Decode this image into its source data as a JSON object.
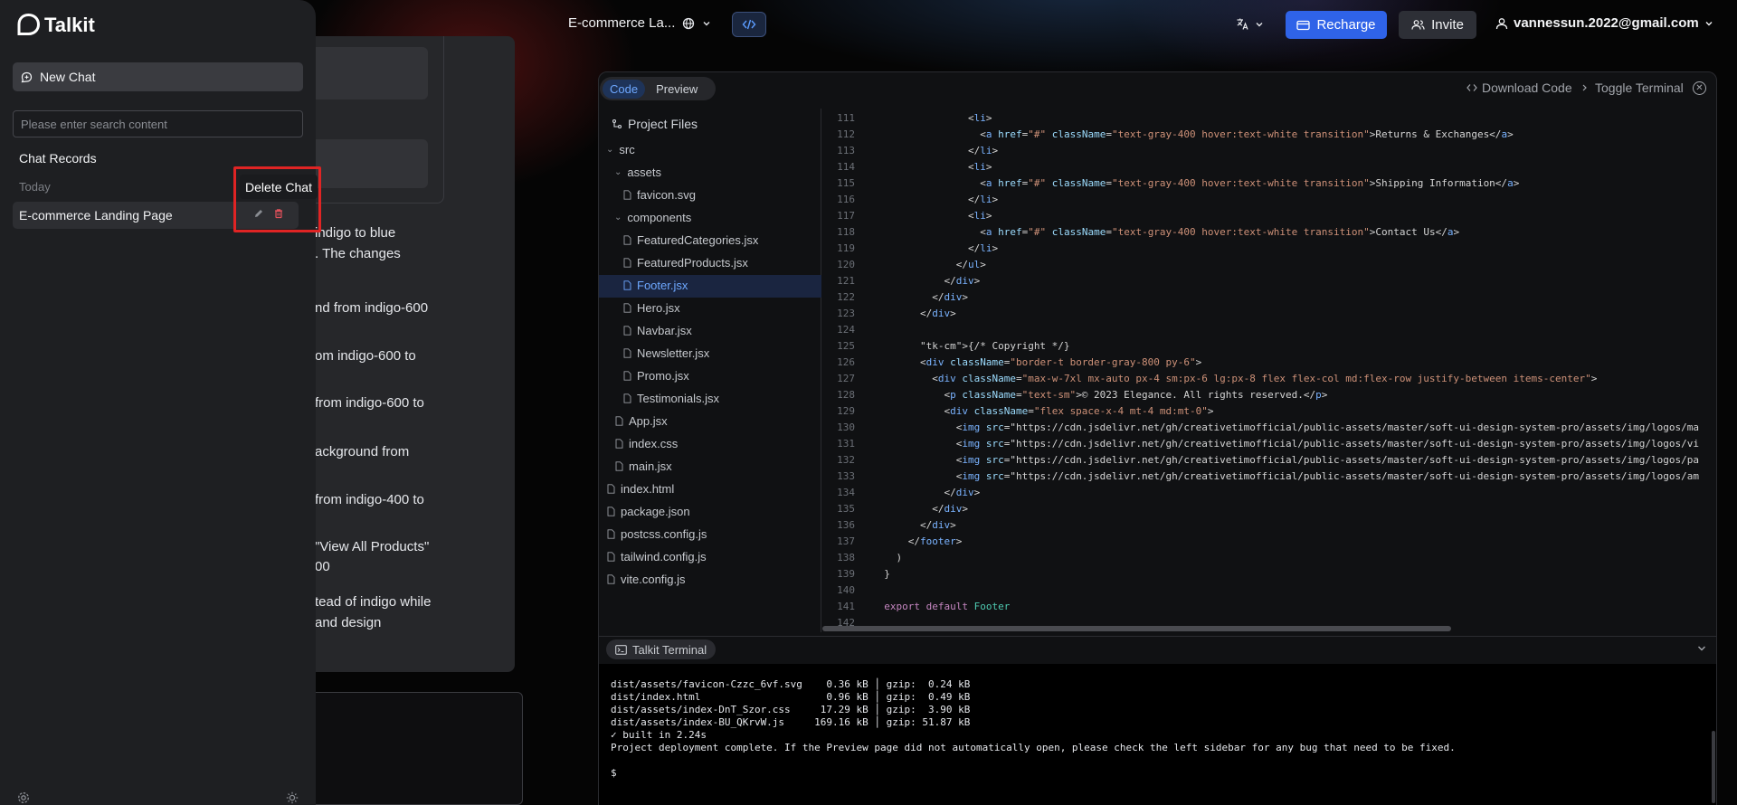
{
  "topbar": {
    "project_title": "E-commerce La...",
    "recharge_label": "Recharge",
    "invite_label": "Invite",
    "account_email": "vannessun.2022@gmail.com"
  },
  "sidebar": {
    "brand": "Talkit",
    "new_chat_label": "New Chat",
    "search_placeholder": "Please enter search content",
    "records_title": "Chat Records",
    "today_label": "Today",
    "chat_item_label": "E-commerce Landing Page",
    "tooltip": "Delete Chat"
  },
  "chat_background": {
    "lines": [
      "indigo to blue",
      ". The changes",
      "nd from indigo-600",
      "om indigo-600 to",
      "from indigo-600 to",
      "ackground from",
      "from indigo-400 to",
      "\"View All Products\"",
      "00",
      "tead of indigo while",
      "and design"
    ]
  },
  "panel": {
    "tab_code": "Code",
    "tab_preview": "Preview",
    "download_label": "Download Code",
    "toggle_terminal_label": "Toggle Terminal",
    "project_files_label": "Project Files",
    "tree": [
      {
        "name": "src",
        "kind": "folder"
      },
      {
        "name": "assets",
        "kind": "folder"
      },
      {
        "name": "favicon.svg",
        "kind": "file"
      },
      {
        "name": "components",
        "kind": "folder"
      },
      {
        "name": "FeaturedCategories.jsx",
        "kind": "file"
      },
      {
        "name": "FeaturedProducts.jsx",
        "kind": "file"
      },
      {
        "name": "Footer.jsx",
        "kind": "file",
        "active": true
      },
      {
        "name": "Hero.jsx",
        "kind": "file"
      },
      {
        "name": "Navbar.jsx",
        "kind": "file"
      },
      {
        "name": "Newsletter.jsx",
        "kind": "file"
      },
      {
        "name": "Promo.jsx",
        "kind": "file"
      },
      {
        "name": "Testimonials.jsx",
        "kind": "file"
      },
      {
        "name": "App.jsx",
        "kind": "file"
      },
      {
        "name": "index.css",
        "kind": "file"
      },
      {
        "name": "main.jsx",
        "kind": "file"
      },
      {
        "name": "index.html",
        "kind": "file"
      },
      {
        "name": "package.json",
        "kind": "file"
      },
      {
        "name": "postcss.config.js",
        "kind": "file"
      },
      {
        "name": "tailwind.config.js",
        "kind": "file"
      },
      {
        "name": "vite.config.js",
        "kind": "file"
      }
    ]
  },
  "code_lines": [
    {
      "n": "111",
      "t": "                <li>"
    },
    {
      "n": "112",
      "t": "                  <a href=\"#\" className=\"text-gray-400 hover:text-white transition\">Returns & Exchanges</a>"
    },
    {
      "n": "113",
      "t": "                </li>"
    },
    {
      "n": "114",
      "t": "                <li>"
    },
    {
      "n": "115",
      "t": "                  <a href=\"#\" className=\"text-gray-400 hover:text-white transition\">Shipping Information</a>"
    },
    {
      "n": "116",
      "t": "                </li>"
    },
    {
      "n": "117",
      "t": "                <li>"
    },
    {
      "n": "118",
      "t": "                  <a href=\"#\" className=\"text-gray-400 hover:text-white transition\">Contact Us</a>"
    },
    {
      "n": "119",
      "t": "                </li>"
    },
    {
      "n": "120",
      "t": "              </ul>"
    },
    {
      "n": "121",
      "t": "            </div>"
    },
    {
      "n": "122",
      "t": "          </div>"
    },
    {
      "n": "123",
      "t": "        </div>"
    },
    {
      "n": "124",
      "t": ""
    },
    {
      "n": "125",
      "t": "        {/* Copyright */}"
    },
    {
      "n": "126",
      "t": "        <div className=\"border-t border-gray-800 py-6\">"
    },
    {
      "n": "127",
      "t": "          <div className=\"max-w-7xl mx-auto px-4 sm:px-6 lg:px-8 flex flex-col md:flex-row justify-between items-center\">"
    },
    {
      "n": "128",
      "t": "            <p className=\"text-sm\">© 2023 Elegance. All rights reserved.</p>"
    },
    {
      "n": "129",
      "t": "            <div className=\"flex space-x-4 mt-4 md:mt-0\">"
    },
    {
      "n": "130",
      "t": "              <img src=\"https://cdn.jsdelivr.net/gh/creativetimofficial/public-assets/master/soft-ui-design-system-pro/assets/img/logos/ma"
    },
    {
      "n": "131",
      "t": "              <img src=\"https://cdn.jsdelivr.net/gh/creativetimofficial/public-assets/master/soft-ui-design-system-pro/assets/img/logos/vi"
    },
    {
      "n": "132",
      "t": "              <img src=\"https://cdn.jsdelivr.net/gh/creativetimofficial/public-assets/master/soft-ui-design-system-pro/assets/img/logos/pa"
    },
    {
      "n": "133",
      "t": "              <img src=\"https://cdn.jsdelivr.net/gh/creativetimofficial/public-assets/master/soft-ui-design-system-pro/assets/img/logos/am"
    },
    {
      "n": "134",
      "t": "            </div>"
    },
    {
      "n": "135",
      "t": "          </div>"
    },
    {
      "n": "136",
      "t": "        </div>"
    },
    {
      "n": "137",
      "t": "      </footer>"
    },
    {
      "n": "138",
      "t": "    )"
    },
    {
      "n": "139",
      "t": "  }"
    },
    {
      "n": "140",
      "t": ""
    },
    {
      "n": "141",
      "t": "  export default Footer"
    },
    {
      "n": "142",
      "t": ""
    }
  ],
  "terminal": {
    "tab_label": "Talkit Terminal",
    "lines": [
      "dist/assets/favicon-Czzc_6vf.svg    0.36 kB │ gzip:  0.24 kB",
      "dist/index.html                     0.96 kB │ gzip:  0.49 kB",
      "dist/assets/index-DnT_Szor.css     17.29 kB │ gzip:  3.90 kB",
      "dist/assets/index-BU_QKrvW.js     169.16 kB │ gzip: 51.87 kB",
      "✓ built in 2.24s",
      "Project deployment complete. If the Preview page did not automatically open, please check the left sidebar for any bug that need to be fixed.",
      "",
      "$"
    ]
  },
  "colors": {
    "accent": "#2f63e8",
    "highlight_box": "#e02424",
    "active_tab": "#6ea8ff"
  }
}
